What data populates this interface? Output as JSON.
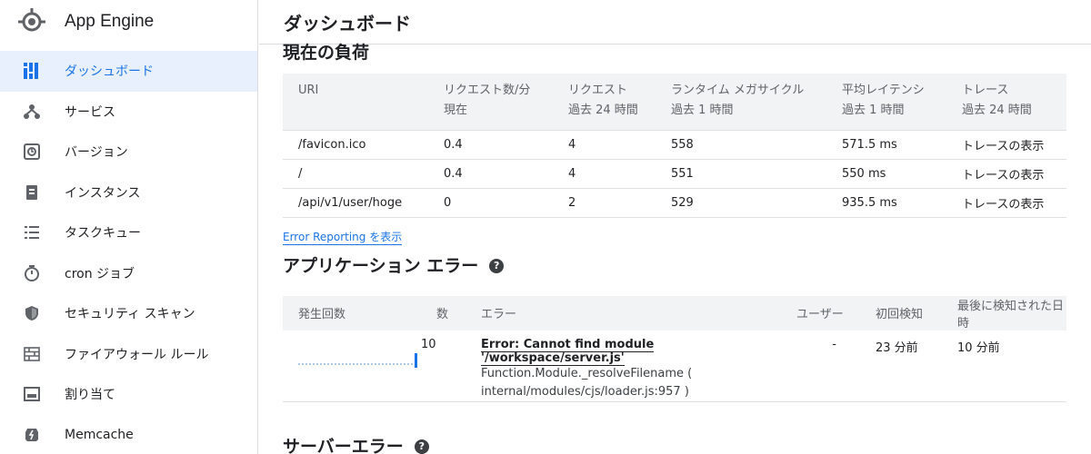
{
  "app": {
    "title": "App Engine"
  },
  "sidebar": {
    "items": [
      {
        "label": "ダッシュボード",
        "icon": "dashboard-icon",
        "active": true
      },
      {
        "label": "サービス",
        "icon": "services-icon"
      },
      {
        "label": "バージョン",
        "icon": "versions-icon"
      },
      {
        "label": "インスタンス",
        "icon": "instances-icon"
      },
      {
        "label": "タスクキュー",
        "icon": "task-queue-icon"
      },
      {
        "label": "cron ジョブ",
        "icon": "timer-icon"
      },
      {
        "label": "セキュリティ スキャン",
        "icon": "shield-icon"
      },
      {
        "label": "ファイアウォール ルール",
        "icon": "firewall-icon"
      },
      {
        "label": "割り当て",
        "icon": "quota-icon"
      },
      {
        "label": "Memcache",
        "icon": "memcache-icon"
      }
    ]
  },
  "header": {
    "title": "ダッシュボード"
  },
  "load": {
    "title": "現在の負荷",
    "columns": [
      {
        "h1": "URI",
        "h2": ""
      },
      {
        "h1": "リクエスト数/分",
        "h2": "現在"
      },
      {
        "h1": "リクエスト",
        "h2": "過去 24 時間"
      },
      {
        "h1": "ランタイム メガサイクル",
        "h2": "過去 1 時間"
      },
      {
        "h1": "平均レイテンシ",
        "h2": "過去 1 時間"
      },
      {
        "h1": "トレース",
        "h2": "過去 24 時間"
      }
    ],
    "rows": [
      [
        "/favicon.ico",
        "0.4",
        "4",
        "558",
        "571.5 ms",
        "トレースの表示"
      ],
      [
        "/",
        "0.4",
        "4",
        "551",
        "550 ms",
        "トレースの表示"
      ],
      [
        "/api/v1/user/hoge",
        "0",
        "2",
        "529",
        "935.5 ms",
        "トレースの表示"
      ]
    ]
  },
  "error_reporting_link": "Error Reporting を表示",
  "app_errors": {
    "title": "アプリケーション エラー",
    "help": "?",
    "columns": [
      "発生回数",
      "数",
      "エラー",
      "ユーザー",
      "初回検知",
      "最後に検知された日時"
    ],
    "rows": [
      {
        "count": "10",
        "error": "Error: Cannot find module '/workspace/server.js'",
        "detail1": "Function.Module._resolveFilename (",
        "detail2": "internal/modules/cjs/loader.js:957 )",
        "users": "-",
        "first": "23 分前",
        "last": "10 分前"
      }
    ]
  },
  "server_errors": {
    "title": "サーバーエラー",
    "help": "?"
  },
  "colors": {
    "accent": "#1a73e8",
    "active_bg": "#e8f0fe",
    "header_bg": "#f1f3f4"
  }
}
